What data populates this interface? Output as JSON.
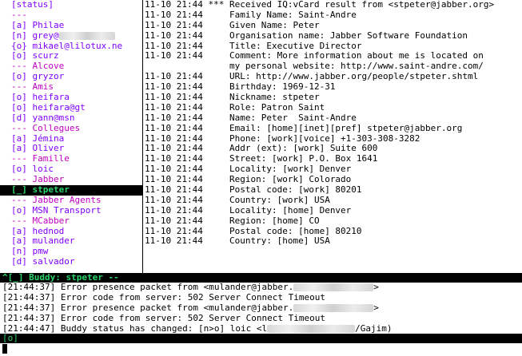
{
  "roster": [
    {
      "text": "[status]",
      "kind": "status"
    },
    {
      "text": "---",
      "kind": "group"
    },
    {
      "text": "[a] Philae",
      "kind": "buddy"
    },
    {
      "text": "[n] grey@",
      "kind": "buddy",
      "blur": true
    },
    {
      "text": "{o} mikael@lilotux.ne",
      "kind": "buddy"
    },
    {
      "text": "[o] scurz",
      "kind": "buddy"
    },
    {
      "text": "--- Alcove",
      "kind": "group"
    },
    {
      "text": "[o] gryzor",
      "kind": "buddy"
    },
    {
      "text": "--- Amis",
      "kind": "group"
    },
    {
      "text": "[o] heifara",
      "kind": "buddy"
    },
    {
      "text": "[o] heifara@gt",
      "kind": "buddy"
    },
    {
      "text": "[d] yann@msn",
      "kind": "buddy"
    },
    {
      "text": "--- Collegues",
      "kind": "group"
    },
    {
      "text": "[a] Jémina",
      "kind": "buddy"
    },
    {
      "text": "[a] Oliver",
      "kind": "buddy"
    },
    {
      "text": "--- Famille",
      "kind": "group"
    },
    {
      "text": "[o] loic",
      "kind": "buddy"
    },
    {
      "text": "--- Jabber",
      "kind": "group"
    },
    {
      "text": "[_] stpeter",
      "kind": "selected"
    },
    {
      "text": "--- Jabber Agents",
      "kind": "group"
    },
    {
      "text": "[o] MSN Transport",
      "kind": "buddy"
    },
    {
      "text": "--- MCabber",
      "kind": "group"
    },
    {
      "text": "[a] hednod",
      "kind": "buddy"
    },
    {
      "text": "[a] mulander",
      "kind": "buddy"
    },
    {
      "text": "[n] pmw",
      "kind": "buddy"
    },
    {
      "text": "[d] salvador",
      "kind": "buddy"
    }
  ],
  "chat": [
    {
      "ts": "11-10 21:44",
      "mark": "***",
      "msg": "Received IQ:vCard result from <stpeter@jabber.org>"
    },
    {
      "ts": "11-10 21:44",
      "mark": "",
      "msg": "Family Name: Saint-Andre"
    },
    {
      "ts": "11-10 21:44",
      "mark": "",
      "msg": "Given Name: Peter"
    },
    {
      "ts": "11-10 21:44",
      "mark": "",
      "msg": "Organisation name: Jabber Software Foundation"
    },
    {
      "ts": "11-10 21:44",
      "mark": "",
      "msg": "Title: Executive Director"
    },
    {
      "ts": "11-10 21:44",
      "mark": "",
      "msg": "Comment: More information about me is located on"
    },
    {
      "ts": "",
      "mark": "",
      "msg": "my personal website: http://www.saint-andre.com/"
    },
    {
      "ts": "11-10 21:44",
      "mark": "",
      "msg": "URL: http://www.jabber.org/people/stpeter.shtml"
    },
    {
      "ts": "11-10 21:44",
      "mark": "",
      "msg": "Birthday: 1969-12-31"
    },
    {
      "ts": "11-10 21:44",
      "mark": "",
      "msg": "Nickname: stpeter"
    },
    {
      "ts": "11-10 21:44",
      "mark": "",
      "msg": "Role: Patron Saint"
    },
    {
      "ts": "11-10 21:44",
      "mark": "",
      "msg": "Name: Peter  Saint-Andre"
    },
    {
      "ts": "11-10 21:44",
      "mark": "",
      "msg": "Email: [home][inet][pref] stpeter@jabber.org"
    },
    {
      "ts": "11-10 21:44",
      "mark": "",
      "msg": "Phone: [work][voice] +1-303-308-3282"
    },
    {
      "ts": "11-10 21:44",
      "mark": "",
      "msg": "Addr (ext): [work] Suite 600"
    },
    {
      "ts": "11-10 21:44",
      "mark": "",
      "msg": "Street: [work] P.O. Box 1641"
    },
    {
      "ts": "11-10 21:44",
      "mark": "",
      "msg": "Locality: [work] Denver"
    },
    {
      "ts": "11-10 21:44",
      "mark": "",
      "msg": "Region: [work] Colorado"
    },
    {
      "ts": "11-10 21:44",
      "mark": "",
      "msg": "Postal code: [work] 80201"
    },
    {
      "ts": "11-10 21:44",
      "mark": "",
      "msg": "Country: [work] USA"
    },
    {
      "ts": "11-10 21:44",
      "mark": "",
      "msg": "Locality: [home] Denver"
    },
    {
      "ts": "11-10 21:44",
      "mark": "",
      "msg": "Region: [home] CO"
    },
    {
      "ts": "11-10 21:44",
      "mark": "",
      "msg": "Postal code: [home] 80210"
    },
    {
      "ts": "11-10 21:44",
      "mark": "",
      "msg": "Country: [home] USA"
    }
  ],
  "status_bar": "^[_] Buddy: stpeter --",
  "log": [
    {
      "pre": "[21:44:37] Error presence packet from <mulander@jabber.",
      "post": ">"
    },
    {
      "pre": "[21:44:37] Error code from server: 502 Server Connect Timeout",
      "post": ""
    },
    {
      "pre": "[21:44:37] Error presence packet from <mulander@jabber.",
      "post": ">"
    },
    {
      "pre": "[21:44:37] Error code from server: 502 Server Connect Timeout",
      "post": ""
    },
    {
      "pre": "[21:44:47] Buddy status has changed: [n>o] loic <l",
      "post": "/Gajim)"
    }
  ],
  "log_blur": [
    false,
    false,
    false,
    false,
    true
  ],
  "input_bar": "[o]",
  "colors": {
    "accent": "#2bd36b",
    "roster_text": "#8000ff",
    "group_text": "#c000c0"
  }
}
